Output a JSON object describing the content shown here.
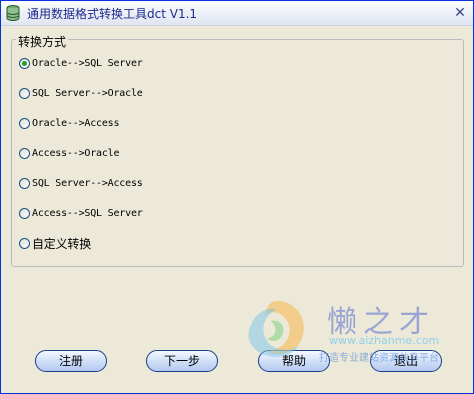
{
  "window": {
    "title": "通用数据格式转换工具dct V1.1",
    "close_glyph": "✕"
  },
  "group": {
    "label": "转换方式",
    "options": [
      {
        "label": "Oracle-->SQL Server",
        "checked": true
      },
      {
        "label": "SQL Server-->Oracle",
        "checked": false
      },
      {
        "label": "Oracle-->Access",
        "checked": false
      },
      {
        "label": "Access-->Oracle",
        "checked": false
      },
      {
        "label": "SQL Server-->Access",
        "checked": false
      },
      {
        "label": "Access-->SQL Server",
        "checked": false
      },
      {
        "label": "自定义转换",
        "checked": false
      }
    ]
  },
  "buttons": {
    "register": "注册",
    "next": "下一步",
    "help": "帮助",
    "exit": "退出"
  },
  "watermark": {
    "logo_text": "懒之才",
    "url": "www.aizhanme.com",
    "slogan": "打造专业建站资源共享平台"
  },
  "colors": {
    "window_border": "#0831d9",
    "titlebar_text": "#1c2a8c",
    "radio_dot": "#21a121",
    "button_border": "#1b3f85"
  },
  "icons": {
    "app": "database-icon",
    "close": "close-icon"
  }
}
